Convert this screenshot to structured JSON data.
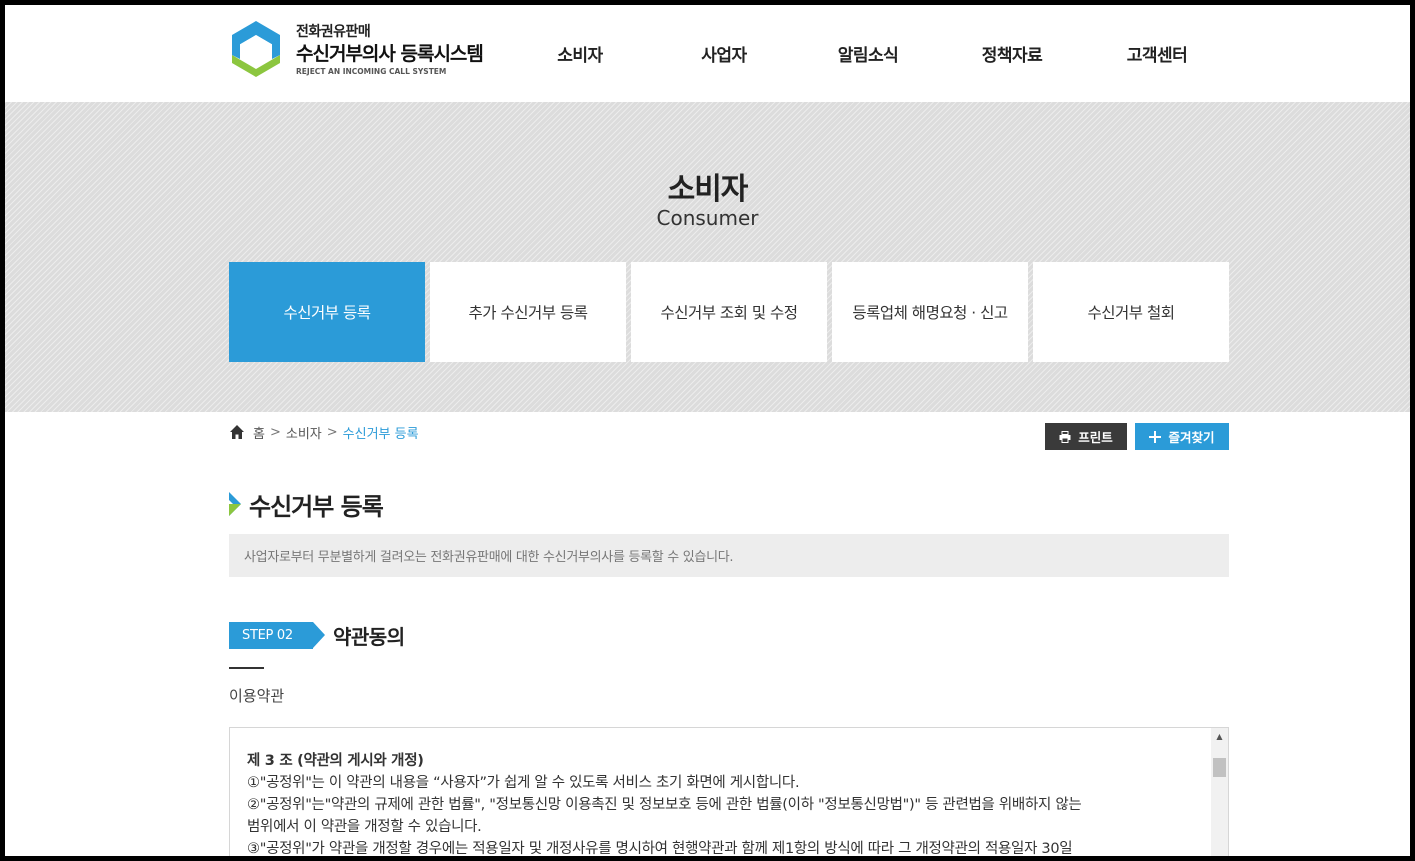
{
  "header": {
    "logo_top": "전화권유판매",
    "logo_main": "수신거부의사 등록시스템",
    "logo_sub": "REJECT AN INCOMING CALL SYSTEM",
    "nav": [
      "소비자",
      "사업자",
      "알림소식",
      "정책자료",
      "고객센터"
    ]
  },
  "visual": {
    "title": "소비자",
    "subtitle": "Consumer",
    "tabs": [
      {
        "label": "수신거부 등록",
        "active": true
      },
      {
        "label": "추가 수신거부 등록",
        "active": false
      },
      {
        "label": "수신거부 조회 및 수정",
        "active": false
      },
      {
        "label": "등록업체 해명요청 · 신고",
        "active": false
      },
      {
        "label": "수신거부 철회",
        "active": false
      }
    ]
  },
  "location": {
    "home": "홈",
    "level1": "소비자",
    "current": "수신거부 등록",
    "separator": ">"
  },
  "utility": {
    "print_label": "프린트",
    "favorite_label": "즐겨찾기"
  },
  "content": {
    "page_title": "수신거부 등록",
    "description": "사업자로부터 무분별하게 걸려오는 전화권유판매에 대한 수신거부의사를 등록할 수 있습니다.",
    "step_badge": "STEP 02",
    "step_title": "약관동의",
    "terms_label": "이용약관",
    "terms_lines": [
      "제 3 조 (약관의 게시와 개정)",
      "①\"공정위\"는 이 약관의 내용을 “사용자”가 쉽게 알 수 있도록 서비스 초기 화면에 게시합니다.",
      "②\"공정위\"는\"약관의 규제에 관한 법률\", \"정보통신망 이용촉진 및 정보보호 등에 관한 법률(이하 \"정보통신망법\")\" 등 관련법을 위배하지 않는",
      "범위에서 이 약관을 개정할 수 있습니다.",
      "③\"공정위\"가 약관을 개정할 경우에는 적용일자 및 개정사유를 명시하여 현행약관과 함께 제1항의 방식에 따라 그 개정약관의 적용일자 30일"
    ]
  },
  "colors": {
    "accent": "#2b9bd8",
    "dark_button": "#3a3a3a",
    "banner_bg": "#dcdcdc",
    "logo_blue": "#2b9bd8",
    "logo_green": "#8cc63f"
  },
  "icons": {
    "home": "home-icon",
    "print": "printer-icon",
    "favorite": "plus-icon",
    "title_mark": "chevron-right-icon"
  }
}
